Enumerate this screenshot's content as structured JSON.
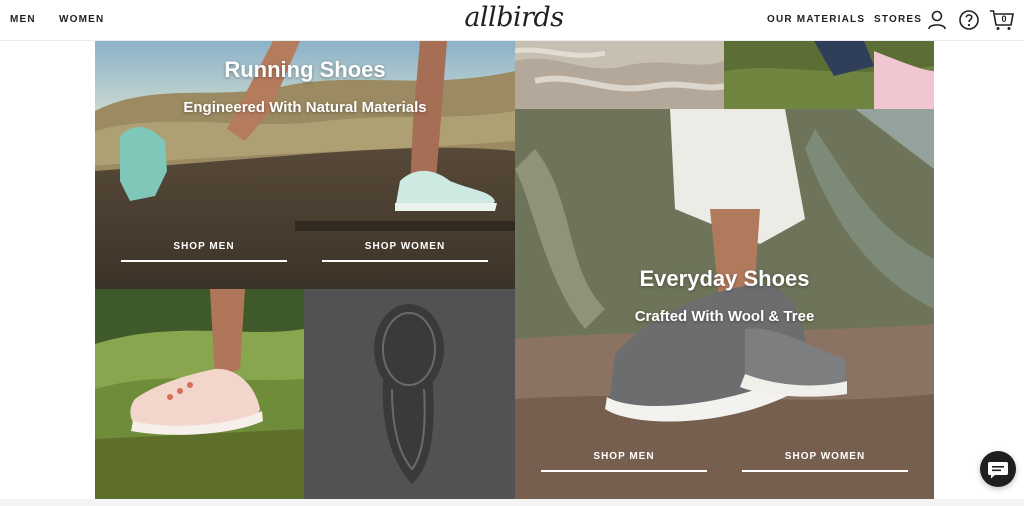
{
  "header": {
    "nav_left": [
      {
        "label": "MEN"
      },
      {
        "label": "WOMEN"
      }
    ],
    "logo": "allbirds",
    "nav_right": [
      {
        "label": "OUR MATERIALS"
      },
      {
        "label": "STORES"
      }
    ],
    "cart_count": "0",
    "icons": [
      "account-icon",
      "help-icon",
      "cart-icon"
    ]
  },
  "running": {
    "title": "Running Shoes",
    "subtitle": "Engineered With Natural Materials",
    "shop_men": "SHOP MEN",
    "shop_women": "SHOP WOMEN"
  },
  "everyday": {
    "title": "Everyday Shoes",
    "subtitle": "Crafted With Wool & Tree",
    "shop_men": "SHOP MEN",
    "shop_women": "SHOP WOMEN"
  },
  "colors": {
    "text_dark": "#212121",
    "overlay_text": "#ffffff",
    "chat_button": "#1f1f1f"
  },
  "chat": {
    "icon": "chat-icon"
  }
}
